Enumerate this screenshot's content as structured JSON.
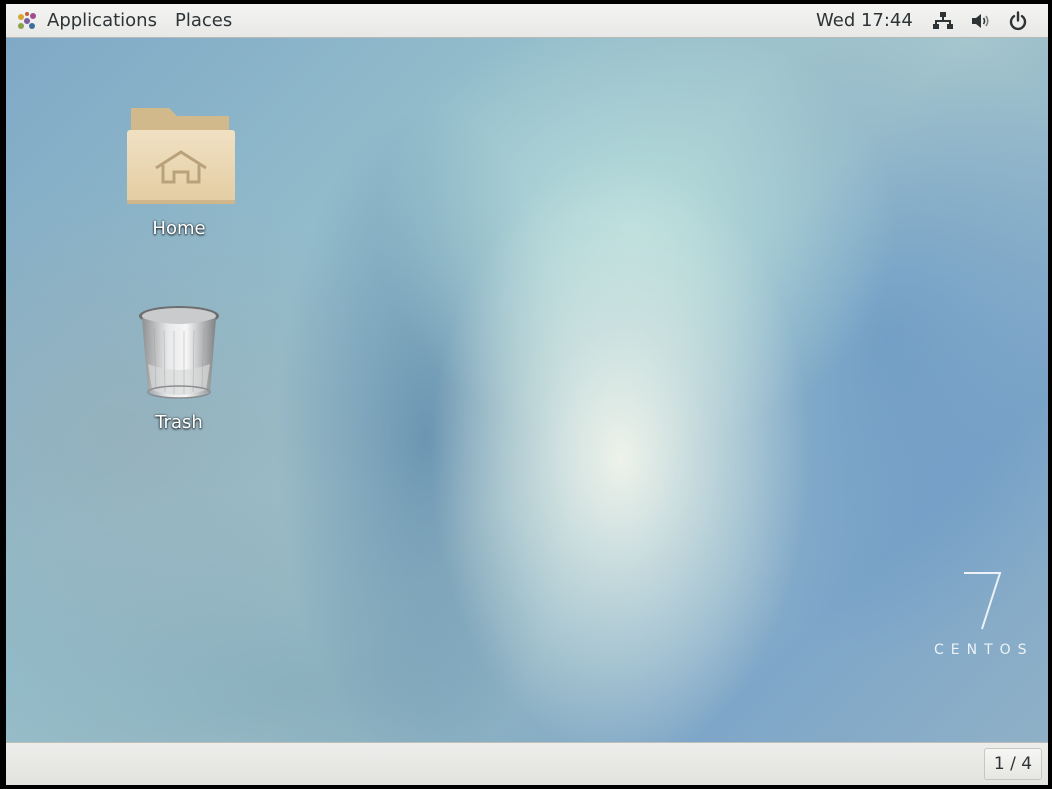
{
  "topbar": {
    "applications_label": "Applications",
    "places_label": "Places",
    "clock": "Wed 17:44",
    "icons": {
      "activities": "gnome-foot-icon",
      "network": "network-wired-icon",
      "volume": "volume-icon",
      "power": "power-icon"
    }
  },
  "desktop": {
    "icons": [
      {
        "label": "Home",
        "icon": "home-folder-icon"
      },
      {
        "label": "Trash",
        "icon": "trash-icon"
      }
    ],
    "wallpaper": {
      "number": "7",
      "brand": "CENTOS"
    }
  },
  "bottombar": {
    "workspace": "1 / 4"
  },
  "colors": {
    "panel": "#eaeae8",
    "text": "#2e3436",
    "folder": "#e6d2ad"
  }
}
